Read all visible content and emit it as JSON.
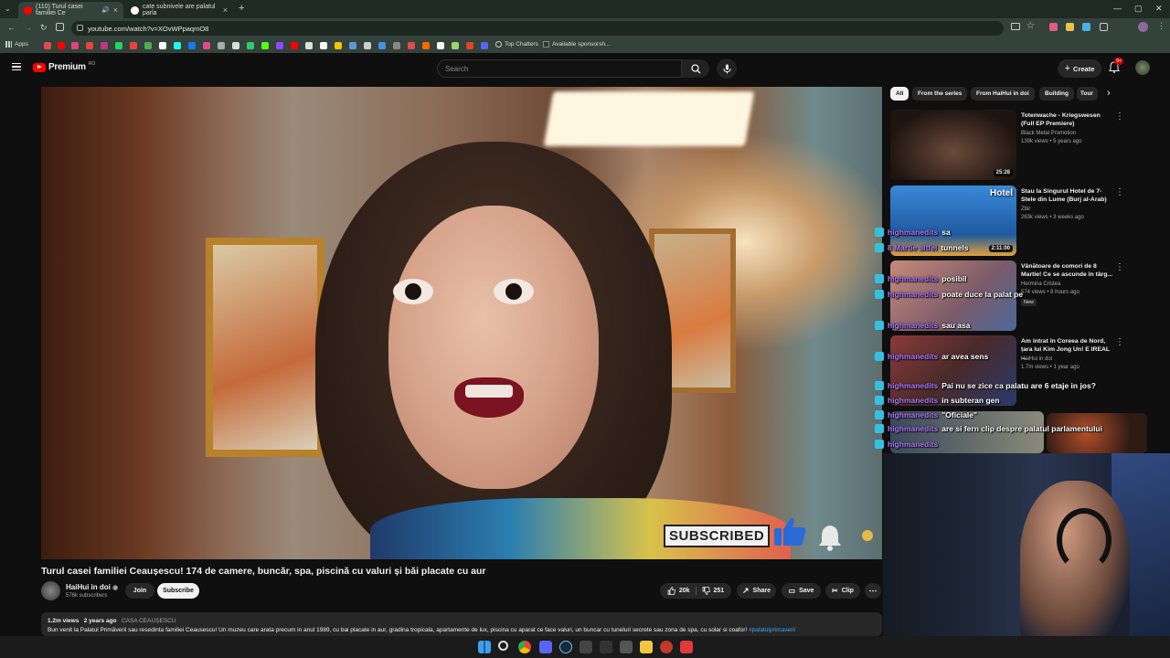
{
  "browser": {
    "tabs": [
      {
        "label": "(110) Turul casei familiei Ce",
        "active": true
      },
      {
        "label": "cate subnivele are palatul parla",
        "active": false
      }
    ],
    "url": "youtube.com/watch?v=XOvWPpaqmO8",
    "bookmarks": {
      "apps_label": "Apps",
      "top_chatters": "Top Chatters",
      "sponsorships": "Available sponsorsh..."
    }
  },
  "youtube": {
    "logo": "Premium",
    "logo_sup": "RO",
    "search_placeholder": "Search",
    "create_label": "Create",
    "notif_count": "9+"
  },
  "video": {
    "title": "Turul casei familiei Ceaușescu! 174 de camere, buncăr, spa, piscină cu valuri și băi placate cu aur",
    "overlay_text": "SUBSCRIBED",
    "channel": "HaiHui in doi",
    "subscribers": "576k subscribers",
    "join_label": "Join",
    "subscribe_label": "Subscribe",
    "likes": "20k",
    "dislikes": "251",
    "share_label": "Share",
    "save_label": "Save",
    "clip_label": "Clip",
    "views": "1.2m views",
    "age": "2 years ago",
    "tag": "CASA CEAUȘESCU",
    "description": "Bun venit la Palatul Primăverii sau resedinta familiei Ceausescu! Un muzeu care arata precum in anul 1989, cu bai placate in aur, gradina tropicala, apartamente de lux, piscina cu aparat ce face valuri, un buncar cu tuneluri secrete sau zona de spa, cu solar si coafor!",
    "hashtag": "#palatulprimaverii"
  },
  "chips": [
    "All",
    "From the series",
    "From HaiHui in doi",
    "Building",
    "Tour"
  ],
  "recommendations": [
    {
      "title": "Totenwache - Kriegswesen (Full EP Premiere)",
      "channel": "Black Metal Promotion",
      "meta": "139k views • 5 years ago",
      "duration": "25:28",
      "thumb": "#3a2a22"
    },
    {
      "title": "Stau la Singurul Hotel de 7-Stele din Lume (Burj al-Arab)",
      "channel": "Zbir",
      "meta": "263k views • 3 weeks ago",
      "duration": "2:11:00",
      "thumb": "#2d6aa8"
    },
    {
      "title": "Vânătoare de comori de 8 Martie! Ce se ascunde în târg...",
      "channel": "Hermina Cristea",
      "meta": "574 views • 8 hours ago",
      "duration": "",
      "thumb": "#a56a5a"
    },
    {
      "title": "Am intrat în Coreea de Nord, țara lui Kim Jong Un! E IREAL ...",
      "channel": "HaiHui in doi",
      "meta": "1.7m views • 1 year ago",
      "duration": "",
      "thumb": "#5a3a3a"
    }
  ],
  "rec_badge_new": "New",
  "chat": [
    {
      "user": "highmanedits",
      "msg": "sa"
    },
    {
      "user": "8 Martie altfel",
      "msg": "tunnels"
    },
    {
      "user": "highmanedits",
      "msg": "posibil"
    },
    {
      "user": "highmanedits",
      "msg": "poate duce la palat pe"
    },
    {
      "user": "highmanedits",
      "msg": "sau asa"
    },
    {
      "user": "highmanedits",
      "msg": "ar avea sens"
    },
    {
      "user": "highmanedits",
      "msg": "Pai nu se zice ca palatu are 6 etaje in jos?"
    },
    {
      "user": "highmanedits",
      "msg": "in subteran gen"
    },
    {
      "user": "highmanedits",
      "msg": "\"Oficiale\""
    },
    {
      "user": "highmanedits",
      "msg": "are si fern clip despre palatul parlamentului"
    },
    {
      "user": "highmanedits",
      "msg": ""
    }
  ]
}
